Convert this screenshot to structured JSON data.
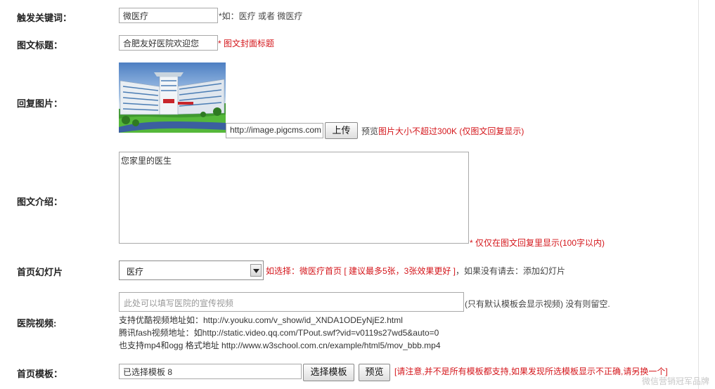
{
  "trigger_keyword": {
    "label": "触发关键词：",
    "value": "微医疗",
    "hint": "*如：医疗 或者 微医疗"
  },
  "article_title": {
    "label": "图文标题：",
    "value": "合肥友好医院欢迎您",
    "hint": "* 图文封面标题"
  },
  "reply_image": {
    "label": "回复图片：",
    "url_value": "http://image.pigcms.com",
    "upload_label": "上传",
    "preview_label": "预览",
    "hint": "图片大小不超过300K (仅图文回复显示)"
  },
  "article_intro": {
    "label": "图文介绍：",
    "value": "您家里的医生",
    "hint": "* 仅仅在图文回复里显示(100字以内)"
  },
  "home_slideshow": {
    "label": "首页幻灯片",
    "selected": "医疗",
    "hint_red": "如选择：微医疗首页 [ 建议最多5张，3张效果更好 ]",
    "hint_rest": "，如果没有请去：添加幻灯片"
  },
  "hospital_video": {
    "label": "医院视频:",
    "placeholder": "此处可以填写医院的宣传视频",
    "side_hint": "(只有默认模板会显示视频) 没有则留空.",
    "support_lines": [
      "支持优酷视频地址如：http://v.youku.com/v_show/id_XNDA1ODEyNjE2.html",
      "腾讯fash视频地址：如http://static.video.qq.com/TPout.swf?vid=v0119s27wd5&auto=0",
      "也支持mp4和ogg 格式地址 http://www.w3school.com.cn/example/html5/mov_bbb.mp4"
    ]
  },
  "home_template": {
    "label": "首页模板：",
    "value": "已选择模板 8",
    "choose_label": "选择模板",
    "preview_label": "预览",
    "warning": "[请注意,并不是所有模板都支持,如果发现所选模板显示不正确,请另换一个]"
  },
  "watermark": "微信营销冠军品牌",
  "icons": {
    "dropdown": "chevron-down-icon"
  },
  "colors": {
    "hint_red": "#d4161b",
    "border": "#a9a9a9"
  }
}
